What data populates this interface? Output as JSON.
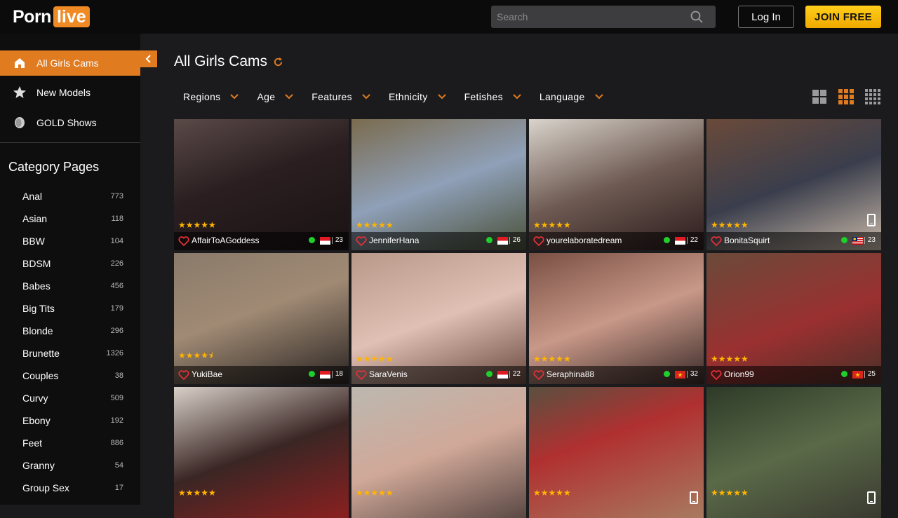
{
  "brand": {
    "part1": "Porn",
    "part2": "live"
  },
  "search": {
    "placeholder": "Search"
  },
  "auth": {
    "login_label": "Log In",
    "join_label": "JOIN FREE"
  },
  "nav": [
    {
      "label": "All Girls Cams",
      "icon": "home-icon",
      "active": true
    },
    {
      "label": "New Models",
      "icon": "star-icon",
      "active": false
    },
    {
      "label": "GOLD Shows",
      "icon": "gold-coin-icon",
      "active": false
    }
  ],
  "categories_title": "Category Pages",
  "categories": [
    {
      "name": "Anal",
      "count": "773"
    },
    {
      "name": "Asian",
      "count": "118"
    },
    {
      "name": "BBW",
      "count": "104"
    },
    {
      "name": "BDSM",
      "count": "226"
    },
    {
      "name": "Babes",
      "count": "456"
    },
    {
      "name": "Big Tits",
      "count": "179"
    },
    {
      "name": "Blonde",
      "count": "296"
    },
    {
      "name": "Brunette",
      "count": "1326"
    },
    {
      "name": "Couples",
      "count": "38"
    },
    {
      "name": "Curvy",
      "count": "509"
    },
    {
      "name": "Ebony",
      "count": "192"
    },
    {
      "name": "Feet",
      "count": "886"
    },
    {
      "name": "Granny",
      "count": "54"
    },
    {
      "name": "Group Sex",
      "count": "17"
    }
  ],
  "page_title": "All Girls Cams",
  "filters": [
    "Regions",
    "Age",
    "Features",
    "Ethnicity",
    "Fetishes",
    "Language"
  ],
  "colors": {
    "accent": "#e07b20",
    "join": "#f5b800",
    "online": "#1fcf2c",
    "stars": "#ffb400"
  },
  "models": [
    {
      "name": "AffairToAGoddess",
      "age": "23",
      "stars": "★★★★★",
      "flag": "indonesia",
      "mobile": false
    },
    {
      "name": "JenniferHana",
      "age": "26",
      "stars": "★★★★★",
      "flag": "indonesia",
      "mobile": false
    },
    {
      "name": "yourelaboratedream",
      "age": "22",
      "stars": "★★★★★",
      "flag": "indonesia",
      "mobile": false
    },
    {
      "name": "BonitaSquirt",
      "age": "23",
      "stars": "★★★★★",
      "flag": "malaysia",
      "mobile": true
    },
    {
      "name": "YukiBae",
      "age": "18",
      "stars": "★★★★⯨",
      "flag": "indonesia",
      "mobile": false
    },
    {
      "name": "SaraVenis",
      "age": "22",
      "stars": "★★★★★",
      "flag": "indonesia",
      "mobile": false
    },
    {
      "name": "Seraphina88",
      "age": "32",
      "stars": "★★★★★",
      "flag": "vietnam",
      "mobile": false
    },
    {
      "name": "Orion99",
      "age": "25",
      "stars": "★★★★★",
      "flag": "vietnam",
      "mobile": false
    },
    {
      "name": "",
      "age": "",
      "stars": "★★★★★",
      "flag": "",
      "mobile": false
    },
    {
      "name": "",
      "age": "",
      "stars": "★★★★★",
      "flag": "",
      "mobile": false
    },
    {
      "name": "",
      "age": "",
      "stars": "★★★★★",
      "flag": "",
      "mobile": true
    },
    {
      "name": "",
      "age": "",
      "stars": "★★★★★",
      "flag": "",
      "mobile": true
    }
  ]
}
